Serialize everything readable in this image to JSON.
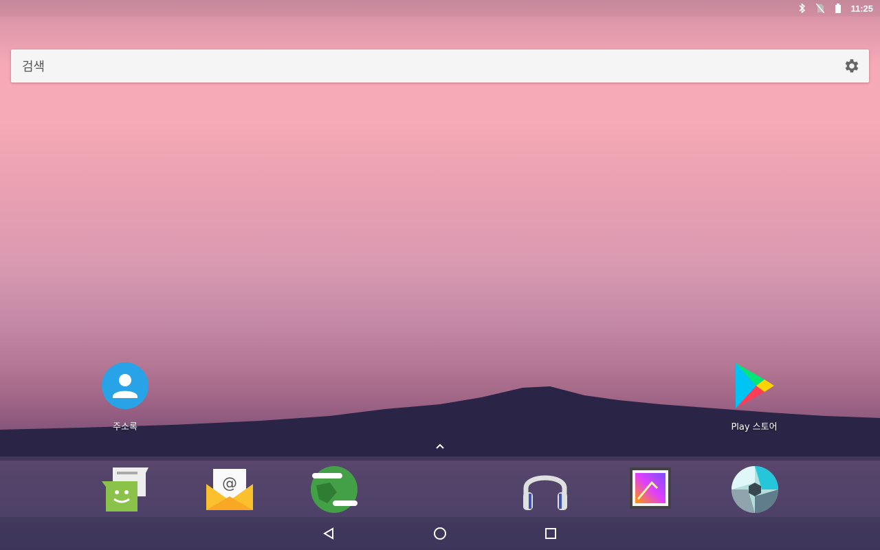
{
  "status_bar": {
    "icons": [
      "bluetooth-icon",
      "no-sim-icon",
      "battery-icon"
    ],
    "time": "11:25"
  },
  "search": {
    "placeholder": "검색",
    "settings_icon": "gear-icon"
  },
  "desktop_apps": [
    {
      "label": "주소록",
      "icon": "contacts-icon",
      "color": "#29a3e8"
    },
    {
      "label": "Play 스토어",
      "icon": "play-store-icon"
    }
  ],
  "all_apps_icon": "chevron-up-icon",
  "dock_apps": [
    {
      "icon": "messaging-icon",
      "color": "#8bc34a"
    },
    {
      "icon": "email-icon",
      "color": "#fbc02d"
    },
    {
      "icon": "maps-icon",
      "color": "#43a047"
    },
    {
      "icon": "music-icon",
      "color": "#dddddd"
    },
    {
      "icon": "gallery-icon",
      "color": "#e040fb"
    },
    {
      "icon": "camera-icon",
      "color": "#26c6da"
    }
  ],
  "nav": {
    "back_icon": "back-icon",
    "home_icon": "home-icon",
    "recents_icon": "recents-icon"
  },
  "colors": {
    "search_bg": "#f5f5f5",
    "dock_bg": "#504869"
  }
}
